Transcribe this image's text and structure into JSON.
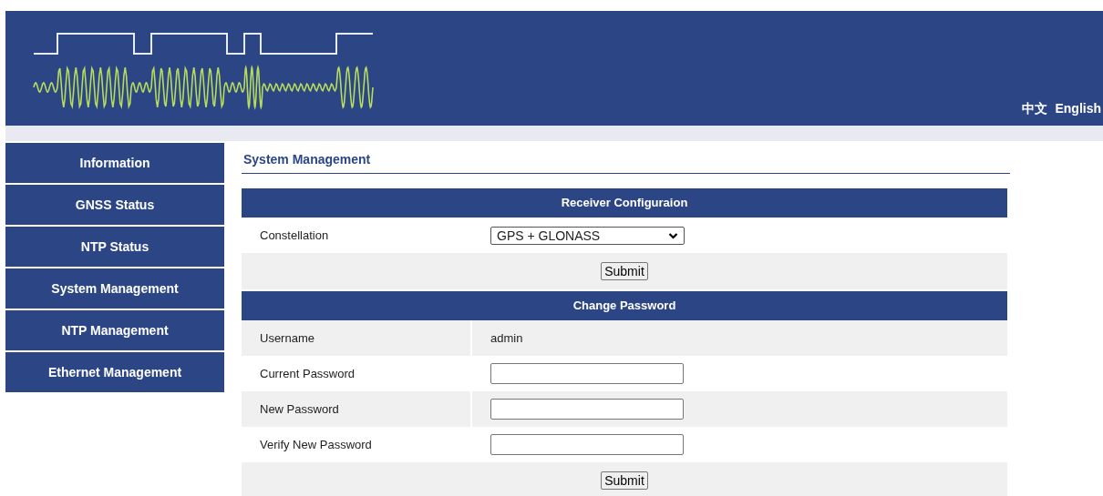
{
  "header": {
    "languages": [
      "中文",
      "English"
    ]
  },
  "sidebar": {
    "items": [
      {
        "label": "Information"
      },
      {
        "label": "GNSS Status"
      },
      {
        "label": "NTP Status"
      },
      {
        "label": "System Management"
      },
      {
        "label": "NTP Management"
      },
      {
        "label": "Ethernet Management"
      }
    ]
  },
  "page_title": "System Management",
  "sections": [
    {
      "title": "Receiver Configuraion",
      "rows": [
        {
          "kind": "select",
          "label": "Constellation",
          "value": "GPS + GLONASS"
        },
        {
          "kind": "submit",
          "button": "Submit"
        }
      ]
    },
    {
      "title": "Change Password",
      "rows": [
        {
          "kind": "text",
          "label": "Username",
          "value": "admin"
        },
        {
          "kind": "password",
          "label": "Current Password"
        },
        {
          "kind": "password",
          "label": "New Password"
        },
        {
          "kind": "password",
          "label": "Verify New Password"
        },
        {
          "kind": "submit",
          "button": "Submit"
        }
      ]
    }
  ]
}
